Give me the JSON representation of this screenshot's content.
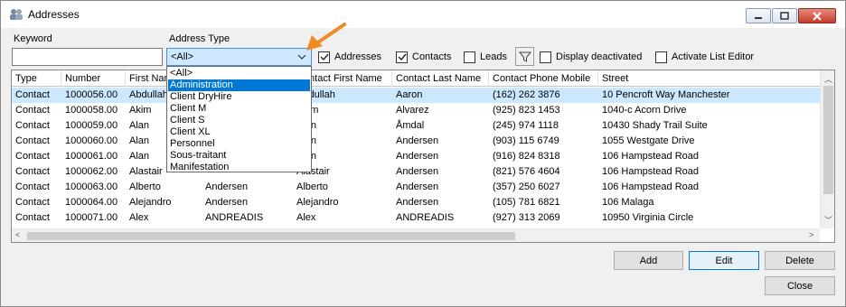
{
  "window": {
    "title": "Addresses"
  },
  "filters": {
    "keyword_label": "Keyword",
    "keyword_value": "",
    "address_type_label": "Address Type",
    "address_type_value": "<All>",
    "checkboxes": [
      {
        "label": "Addresses",
        "checked": true
      },
      {
        "label": "Contacts",
        "checked": true
      },
      {
        "label": "Leads",
        "checked": false
      },
      {
        "label": "Display deactivated",
        "checked": false
      },
      {
        "label": "Activate List Editor",
        "checked": false
      }
    ]
  },
  "dropdown": {
    "options": [
      "<All>",
      "Administration",
      "Client DryHire",
      "Client M",
      "Client S",
      "Client XL",
      "Personnel",
      "Sous-traitant",
      "Manifestation"
    ],
    "highlighted": "Administration"
  },
  "grid": {
    "columns": [
      "Type",
      "Number",
      "First Name",
      "",
      "Contact First Name",
      "Contact Last Name",
      "Contact Phone Mobile",
      "Street"
    ],
    "rows": [
      [
        "Contact",
        "1000056.00",
        "Abdullah",
        "",
        "Abdullah",
        "Aaron",
        "(162) 262 3876",
        "10 Pencroft Way Manchester"
      ],
      [
        "Contact",
        "1000058.00",
        "Akim",
        "",
        "Akim",
        "Alvarez",
        "(925) 823 1453",
        "1040-c Acorn Drive"
      ],
      [
        "Contact",
        "1000059.00",
        "Alan",
        "",
        "Alan",
        "Åmdal",
        "(245) 974 1118",
        "10430 Shady Trail Suite"
      ],
      [
        "Contact",
        "1000060.00",
        "Alan",
        "",
        "Alan",
        "Andersen",
        "(903) 115 6749",
        "1055 Westgate Drive"
      ],
      [
        "Contact",
        "1000061.00",
        "Alan",
        "",
        "Alan",
        "Andersen",
        "(916) 824 8318",
        "106 Hampstead Road"
      ],
      [
        "Contact",
        "1000062.00",
        "Alastair",
        "",
        "Alastair",
        "Andersen",
        "(821) 576 4604",
        "106 Hampstead Road"
      ],
      [
        "Contact",
        "1000063.00",
        "Alberto",
        "Andersen",
        "Alberto",
        "Andersen",
        "(357) 250 6027",
        "106 Hampstead Road"
      ],
      [
        "Contact",
        "1000064.00",
        "Alejandro",
        "Andersen",
        "Alejandro",
        "Andersen",
        "(105) 781 6821",
        "106 Malaga"
      ],
      [
        "Contact",
        "1000071.00",
        "Alex",
        "ANDREADIS",
        "Alex",
        "ANDREADIS",
        "(927) 313 2069",
        "10950 Virginia Circle"
      ]
    ]
  },
  "buttons": {
    "add": "Add",
    "edit": "Edit",
    "delete": "Delete",
    "close": "Close"
  },
  "colors": {
    "selection": "#cce8ff",
    "highlight": "#0078d7",
    "annotation_arrow": "#f08a24"
  }
}
